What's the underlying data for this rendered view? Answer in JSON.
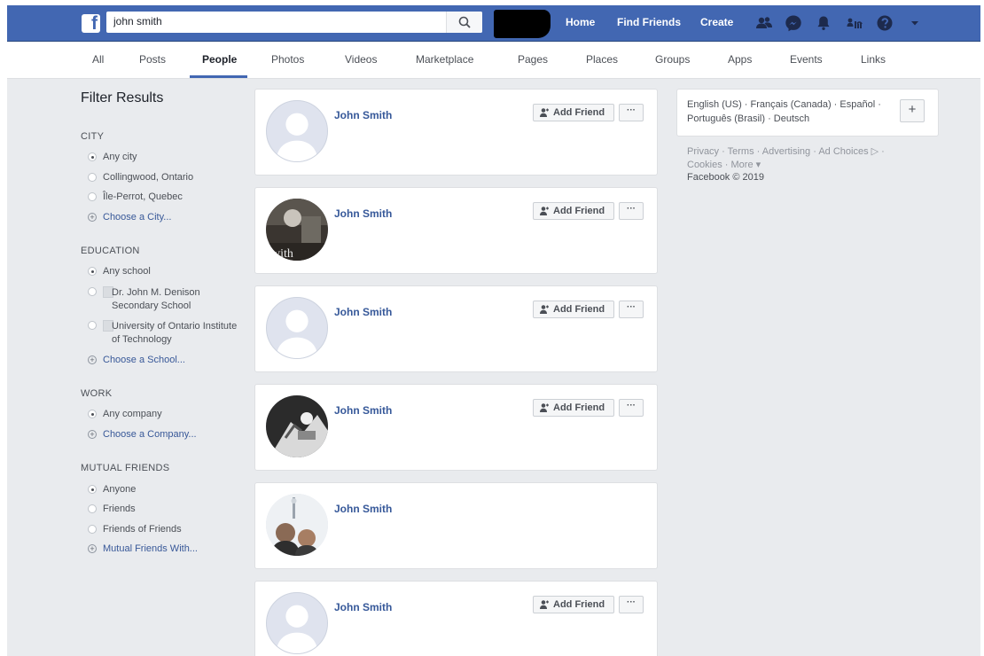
{
  "search": {
    "value": "john smith"
  },
  "logo": "f",
  "nav": {
    "home": "Home",
    "find_friends": "Find Friends",
    "create": "Create"
  },
  "tabs": [
    "All",
    "Posts",
    "People",
    "Photos",
    "Videos",
    "Marketplace",
    "Pages",
    "Places",
    "Groups",
    "Apps",
    "Events",
    "Links"
  ],
  "active_tab": "People",
  "filters": {
    "title": "Filter Results",
    "city": {
      "label": "CITY",
      "options": [
        "Any city",
        "Collingwood, Ontario",
        "Île-Perrot, Quebec"
      ],
      "more": "Choose a City..."
    },
    "education": {
      "label": "EDUCATION",
      "options": [
        "Any school",
        "Dr. John M. Denison Secondary School",
        "University of Ontario Institute of Technology"
      ],
      "more": "Choose a School..."
    },
    "work": {
      "label": "WORK",
      "options": [
        "Any company"
      ],
      "more": "Choose a Company..."
    },
    "mutual": {
      "label": "MUTUAL FRIENDS",
      "options": [
        "Anyone",
        "Friends",
        "Friends of Friends"
      ],
      "more": "Mutual Friends With..."
    }
  },
  "results": [
    {
      "name": "John Smith",
      "photo": "default-silhouette",
      "add_friend": "Add Friend",
      "more": "···"
    },
    {
      "name": "John Smith",
      "photo": "profile-photo",
      "add_friend": "Add Friend",
      "more": "···"
    },
    {
      "name": "John Smith",
      "photo": "default-silhouette",
      "add_friend": "Add Friend",
      "more": "···"
    },
    {
      "name": "John Smith",
      "photo": "profile-photo",
      "add_friend": "Add Friend",
      "more": "···"
    },
    {
      "name": "John Smith",
      "photo": "profile-photo"
    },
    {
      "name": "John Smith",
      "photo": "default-silhouette",
      "add_friend": "Add Friend",
      "more": "···"
    }
  ],
  "languages": {
    "text": "English (US) · Français (Canada) · Español · Português (Brasil) · Deutsch",
    "add": "+"
  },
  "footer": {
    "links": "Privacy · Terms · Advertising · Ad Choices ▷ · Cookies · More ▾",
    "copyright": "Facebook © 2019"
  },
  "colors": {
    "brand": "#4267b2",
    "link": "#365899",
    "background": "#e9ebee"
  }
}
